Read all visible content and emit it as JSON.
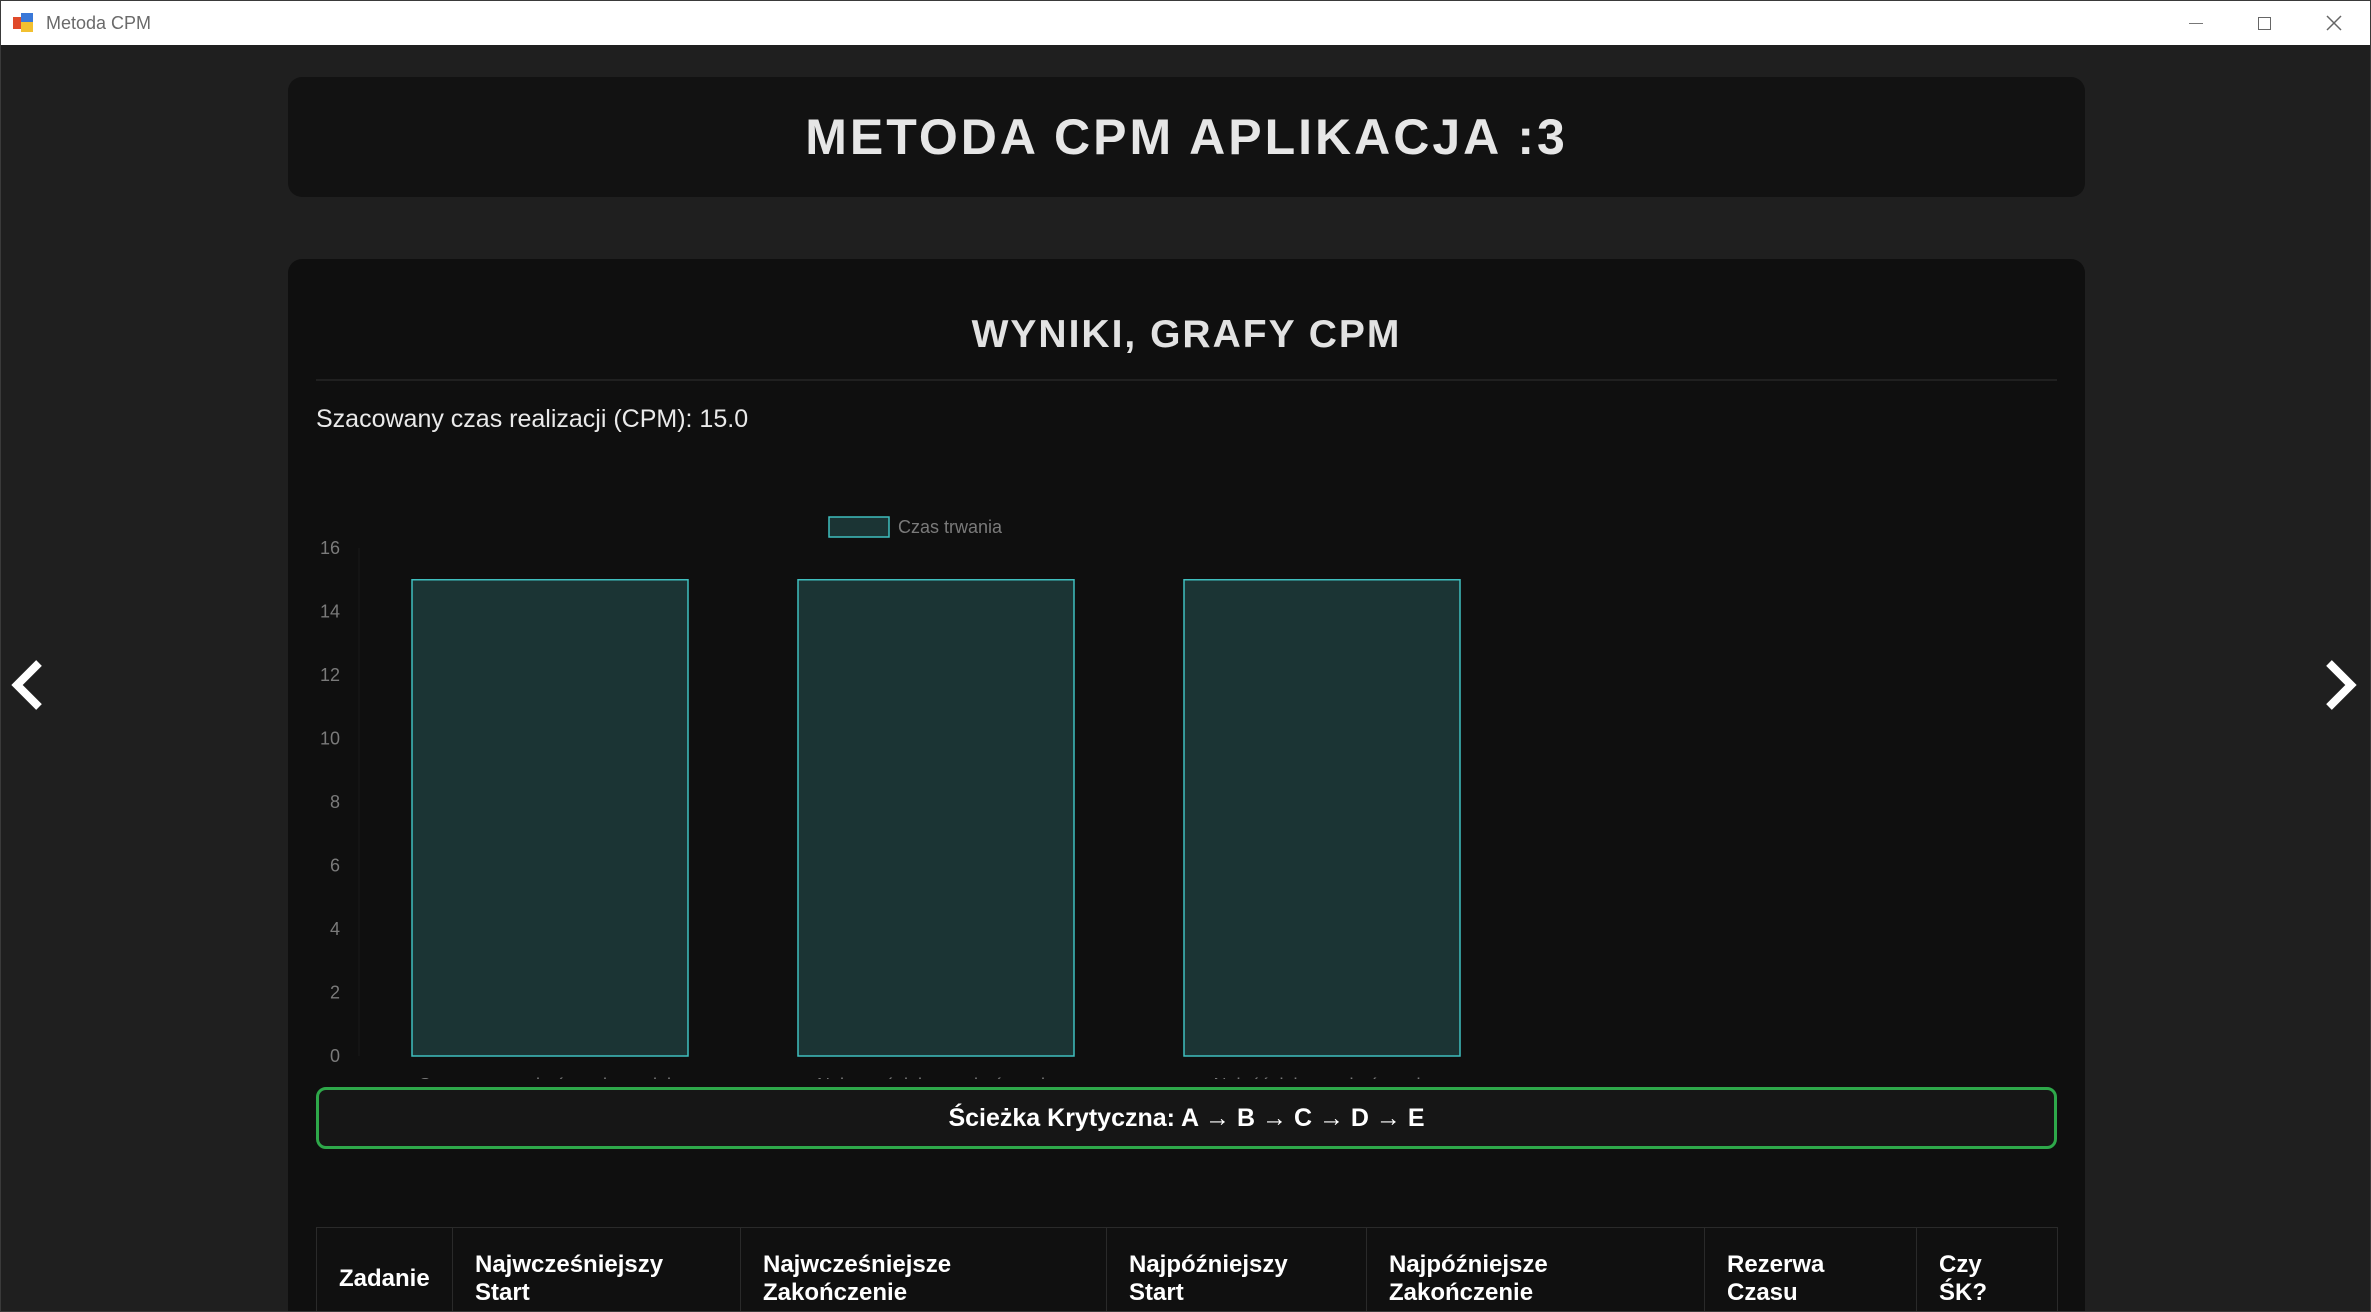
{
  "window": {
    "title": "Metoda CPM"
  },
  "header": {
    "title": "METODA CPM APLIKACJA :3"
  },
  "results": {
    "section_title": "WYNIKI, GRAFY CPM",
    "estimate_text": "Szacowany czas realizacji (CPM): 15.0",
    "critical_path_text": "Ścieżka Krytyczna: A → B → C → D → E"
  },
  "chart_data": {
    "type": "bar",
    "categories": [
      "Szacowane zakończenie modelu",
      "Najwcześniejsze zakończenie",
      "Najpóźniejsze zakończenie"
    ],
    "series": [
      {
        "name": "Czas trwania",
        "values": [
          15,
          15,
          15
        ]
      }
    ],
    "yticks": [
      "0",
      "2",
      "4",
      "6",
      "8",
      "10",
      "12",
      "14",
      "16"
    ],
    "ylim": [
      0,
      16
    ],
    "legend": "top-center",
    "grid": false,
    "colors": {
      "fill": "#1b3434",
      "stroke": "#3fbfbf",
      "tick_text": "#7a7a7a"
    }
  },
  "table": {
    "headers": [
      "Zadanie",
      "Najwcześniejszy Start",
      "Najwcześniejsze Zakończenie",
      "Najpóźniejszy Start",
      "Najpóźniejsze Zakończenie",
      "Rezerwa Czasu",
      "Czy ŚK?"
    ]
  },
  "navigation": {
    "prev_icon": "chevron-left-icon",
    "next_icon": "chevron-right-icon"
  },
  "colors": {
    "accent_green": "#2ea84a",
    "background": "#1f1f1f",
    "card": "#0f0f0f"
  }
}
